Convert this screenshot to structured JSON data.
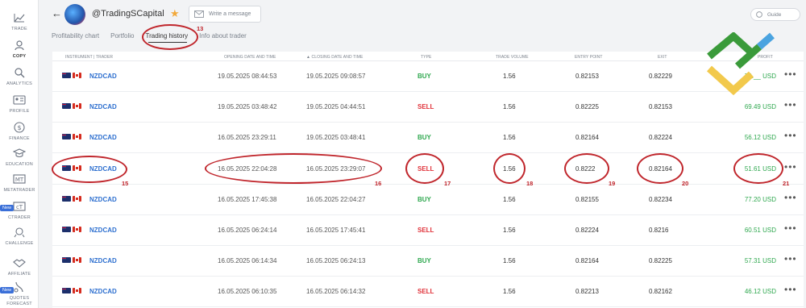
{
  "sidebar": {
    "items": [
      {
        "label": "TRADE",
        "icon": "chart-icon"
      },
      {
        "label": "COPY",
        "icon": "users-icon"
      },
      {
        "label": "ANALYTICS",
        "icon": "analytics-icon"
      },
      {
        "label": "PROFILE",
        "icon": "profile-icon"
      },
      {
        "label": "FINANCE",
        "icon": "dollar-icon"
      },
      {
        "label": "EDUCATION",
        "icon": "graduation-icon"
      },
      {
        "label": "METATRADER",
        "icon": "metatrader-icon"
      },
      {
        "label": "CTRADER",
        "icon": "ctrader-icon"
      },
      {
        "label": "CHALLENGE",
        "icon": "challenge-icon"
      },
      {
        "label": "AFFILIATE",
        "icon": "handshake-icon"
      },
      {
        "label": "QUOTES FORECAST",
        "icon": "quotes-forecast-icon"
      }
    ],
    "new_badge": "New"
  },
  "header": {
    "trader_name": "@TradingSCapital",
    "message_placeholder": "Write a message",
    "guide_label": "Guide"
  },
  "tabs": [
    {
      "label": "Profitability chart"
    },
    {
      "label": "Portfolio"
    },
    {
      "label": "Trading history"
    },
    {
      "label": "Info about trader"
    }
  ],
  "table": {
    "headers": {
      "instrument": "INSTRUMENT | TRADER",
      "opening": "OPENING DATE AND TIME",
      "closing": "▲ CLOSING DATE AND TIME",
      "type": "TYPE",
      "volume": "TRADE VOLUME",
      "entry": "ENTRY POINT",
      "exit": "EXIT",
      "profit": "PROFIT"
    },
    "rows": [
      {
        "symbol": "NZDCAD",
        "open": "19.05.2025 08:44:53",
        "close": "19.05.2025 09:08:57",
        "type": "BUY",
        "volume": "1.56",
        "entry": "0.82153",
        "exit": "0.82229",
        "profit": "73.__ USD"
      },
      {
        "symbol": "NZDCAD",
        "open": "19.05.2025 03:48:42",
        "close": "19.05.2025 04:44:51",
        "type": "SELL",
        "volume": "1.56",
        "entry": "0.82225",
        "exit": "0.82153",
        "profit": "69.49 USD"
      },
      {
        "symbol": "NZDCAD",
        "open": "16.05.2025 23:29:11",
        "close": "19.05.2025 03:48:41",
        "type": "BUY",
        "volume": "1.56",
        "entry": "0.82164",
        "exit": "0.82224",
        "profit": "56.12 USD"
      },
      {
        "symbol": "NZDCAD",
        "open": "16.05.2025 22:04:28",
        "close": "16.05.2025 23:29:07",
        "type": "SELL",
        "volume": "1.56",
        "entry": "0.8222",
        "exit": "0.82164",
        "profit": "51.61 USD"
      },
      {
        "symbol": "NZDCAD",
        "open": "16.05.2025 17:45:38",
        "close": "16.05.2025 22:04:27",
        "type": "BUY",
        "volume": "1.56",
        "entry": "0.82155",
        "exit": "0.82234",
        "profit": "77.20 USD"
      },
      {
        "symbol": "NZDCAD",
        "open": "16.05.2025 06:24:14",
        "close": "16.05.2025 17:45:41",
        "type": "SELL",
        "volume": "1.56",
        "entry": "0.82224",
        "exit": "0.8216",
        "profit": "60.51 USD"
      },
      {
        "symbol": "NZDCAD",
        "open": "16.05.2025 06:14:34",
        "close": "16.05.2025 06:24:13",
        "type": "BUY",
        "volume": "1.56",
        "entry": "0.82164",
        "exit": "0.82225",
        "profit": "57.31 USD"
      },
      {
        "symbol": "NZDCAD",
        "open": "16.05.2025 06:10:35",
        "close": "16.05.2025 06:14:32",
        "type": "SELL",
        "volume": "1.56",
        "entry": "0.82213",
        "exit": "0.82162",
        "profit": "46.12 USD"
      }
    ]
  },
  "annotations": {
    "tab": "13",
    "instrument": "15",
    "dates": "16",
    "type": "17",
    "volume": "18",
    "entry": "19",
    "exit": "20",
    "profit": "21"
  }
}
